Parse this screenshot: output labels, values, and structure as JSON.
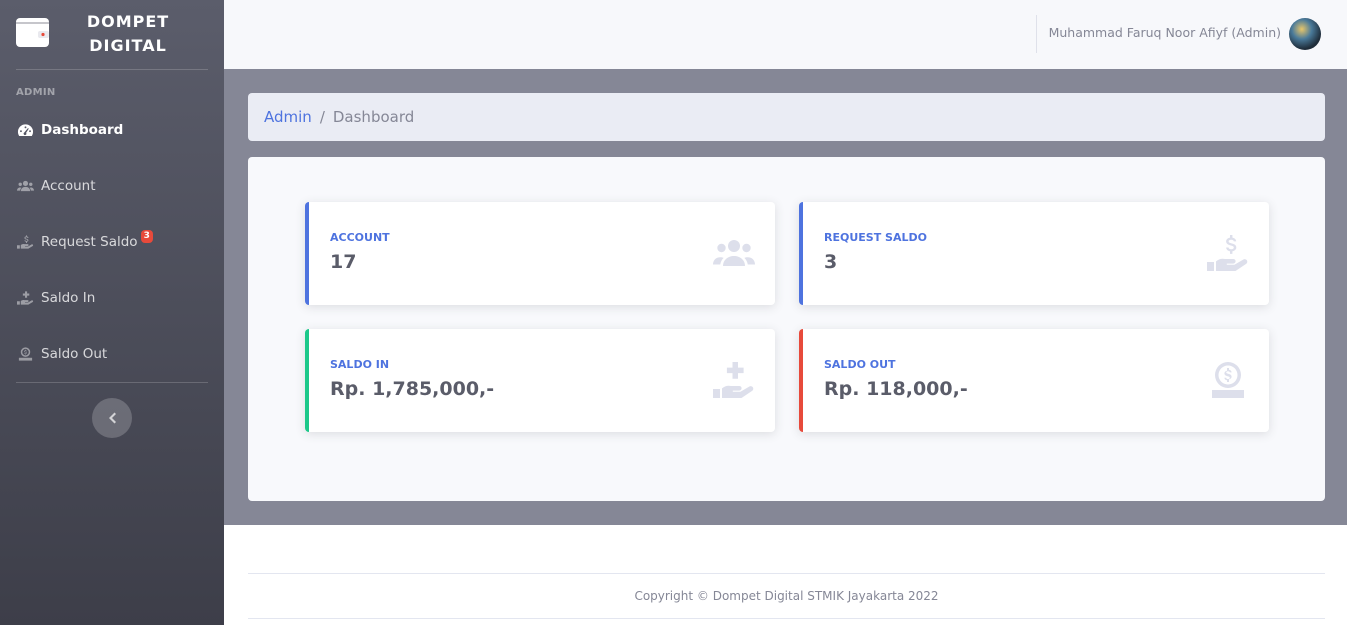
{
  "brand": {
    "line1": "DOMPET",
    "line2": "DIGITAL",
    "logo_icon": "wallet-icon"
  },
  "sidebar": {
    "heading": "ADMIN",
    "items": [
      {
        "label": "Dashboard",
        "icon": "tachometer-icon",
        "active": true
      },
      {
        "label": "Account",
        "icon": "users-icon",
        "active": false
      },
      {
        "label": "Request Saldo",
        "icon": "hand-holding-usd-icon",
        "badge": "3",
        "active": false
      },
      {
        "label": "Saldo In",
        "icon": "hand-holding-medical-icon",
        "active": false
      },
      {
        "label": "Saldo Out",
        "icon": "money-check-icon",
        "active": false
      }
    ],
    "toggle_icon": "chevron-left-icon"
  },
  "topbar": {
    "user_name": "Muhammad Faruq Noor Afiyf (Admin)"
  },
  "breadcrumb": {
    "parent": "Admin",
    "separator": "/",
    "current": "Dashboard"
  },
  "cards": [
    {
      "label": "ACCOUNT",
      "value": "17",
      "icon": "users-icon",
      "accent": "#4e73df"
    },
    {
      "label": "REQUEST SALDO",
      "value": "3",
      "icon": "hand-holding-usd-icon",
      "accent": "#4e73df"
    },
    {
      "label": "SALDO IN",
      "value": "Rp. 1,785,000,-",
      "icon": "hand-holding-medical-icon",
      "accent": "#1cc88a"
    },
    {
      "label": "SALDO OUT",
      "value": "Rp. 118,000,-",
      "icon": "money-check-icon",
      "accent": "#e74a3b"
    }
  ],
  "footer": {
    "copyright": "Copyright © Dompet Digital STMIK Jayakarta 2022"
  }
}
